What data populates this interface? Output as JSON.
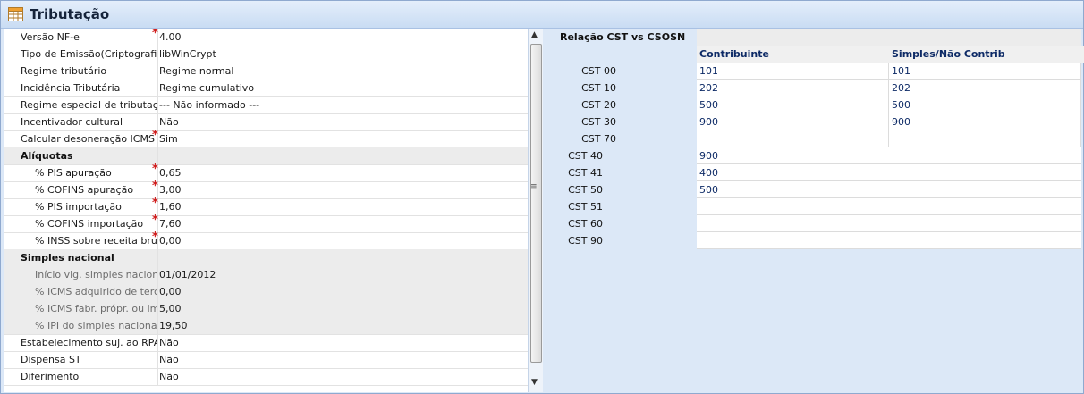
{
  "title": "Tributação",
  "form": {
    "rows": [
      {
        "label": "Versão NF-e",
        "value": "4.00",
        "required": true,
        "type": "field"
      },
      {
        "label": "Tipo de Emissão(Criptografia)",
        "value": "libWinCrypt",
        "required": false,
        "type": "field"
      },
      {
        "label": "Regime tributário",
        "value": "Regime normal",
        "required": false,
        "type": "field"
      },
      {
        "label": "Incidência Tributária",
        "value": "Regime cumulativo",
        "required": false,
        "type": "field"
      },
      {
        "label": "Regime especial de tributação",
        "value": "--- Não informado ---",
        "required": false,
        "type": "field"
      },
      {
        "label": "Incentivador cultural",
        "value": "Não",
        "required": false,
        "type": "field"
      },
      {
        "label": "Calcular desoneração ICMS",
        "value": "Sim",
        "required": true,
        "type": "field"
      },
      {
        "label": "Alíquotas",
        "value": "",
        "required": false,
        "type": "group"
      },
      {
        "label": "% PIS apuração",
        "value": "0,65",
        "required": true,
        "type": "sub"
      },
      {
        "label": "% COFINS apuração",
        "value": "3,00",
        "required": true,
        "type": "sub"
      },
      {
        "label": "% PIS importação",
        "value": "1,60",
        "required": true,
        "type": "sub"
      },
      {
        "label": "% COFINS importação",
        "value": "7,60",
        "required": true,
        "type": "sub"
      },
      {
        "label": "% INSS sobre receita bruta",
        "value": "0,00",
        "required": true,
        "type": "sub"
      },
      {
        "label": "Simples nacional",
        "value": "",
        "required": false,
        "type": "group"
      },
      {
        "label": "Início vig. simples nacional",
        "value": "01/01/2012",
        "required": false,
        "type": "dim"
      },
      {
        "label": "% ICMS adquirido de terc.",
        "value": "0,00",
        "required": false,
        "type": "dim"
      },
      {
        "label": "% ICMS fabr. própr. ou imp",
        "value": "5,00",
        "required": false,
        "type": "dim"
      },
      {
        "label": "% IPI do simples nacional",
        "value": "19,50",
        "required": false,
        "type": "dim"
      },
      {
        "label": "Estabelecimento suj. ao RPA",
        "value": "Não",
        "required": false,
        "type": "field"
      },
      {
        "label": "Dispensa ST",
        "value": "Não",
        "required": false,
        "type": "field"
      },
      {
        "label": "Diferimento",
        "value": "Não",
        "required": false,
        "type": "field"
      }
    ]
  },
  "scrollbar": {
    "up_glyph": "▲",
    "down_glyph": "▼",
    "grip_glyph": "≡"
  },
  "cst_table": {
    "title": "Relação CST vs CSOSN",
    "headers": [
      "Contribuinte",
      "Simples/Não Contrib"
    ],
    "rows_two": [
      {
        "cst": "CST 00",
        "contribuinte": "101",
        "simples": "101"
      },
      {
        "cst": "CST 10",
        "contribuinte": "202",
        "simples": "202"
      },
      {
        "cst": "CST 20",
        "contribuinte": "500",
        "simples": "500"
      },
      {
        "cst": "CST 30",
        "contribuinte": "900",
        "simples": "900"
      },
      {
        "cst": "CST 70",
        "contribuinte": "",
        "simples": ""
      }
    ],
    "rows_one": [
      {
        "cst": "CST 40",
        "value": "900"
      },
      {
        "cst": "CST 41",
        "value": "400"
      },
      {
        "cst": "CST 50",
        "value": "500"
      },
      {
        "cst": "CST 51",
        "value": ""
      },
      {
        "cst": "CST 60",
        "value": ""
      },
      {
        "cst": "CST 90",
        "value": ""
      }
    ]
  },
  "colors": {
    "accent": "#0d2a66",
    "required": "#d01a1a",
    "group_bg": "#ececec"
  }
}
